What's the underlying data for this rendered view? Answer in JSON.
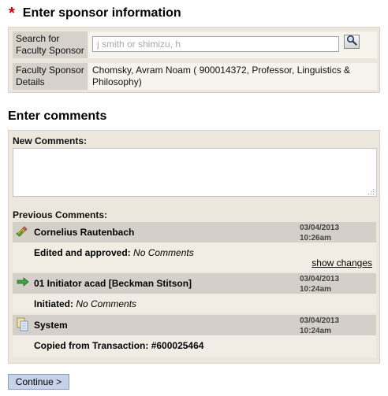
{
  "sponsor_section": {
    "required_mark": "*",
    "title": "Enter sponsor information",
    "search_label": "Search for Faculty Sponsor",
    "search_placeholder": "j smith or shimizu, h",
    "details_label": "Faculty Sponsor Details",
    "details_value": "Chomsky, Avram Noam ( 900014372, Professor, Linguistics & Philosophy)"
  },
  "comments_section": {
    "title": "Enter comments",
    "new_label": "New Comments:",
    "previous_label": "Previous Comments:",
    "entries": [
      {
        "icon": "edit-approve-icon",
        "name": "Cornelius Rautenbach",
        "date": "03/04/2013",
        "time": "10:26am",
        "action": "Edited and approved:",
        "comment": "No Comments",
        "link": "show changes"
      },
      {
        "icon": "green-arrow-icon",
        "name": "01 Initiator acad [Beckman Stitson]",
        "date": "03/04/2013",
        "time": "10:24am",
        "action": "Initiated:",
        "comment": "No Comments"
      },
      {
        "icon": "copy-document-icon",
        "name": "System",
        "date": "03/04/2013",
        "time": "10:24am",
        "action": "Copied from Transaction:",
        "comment": "#600025464"
      }
    ]
  },
  "continue_label": "Continue >"
}
